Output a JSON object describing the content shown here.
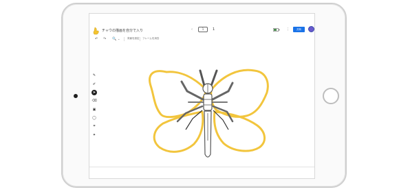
{
  "app": {
    "doc_title": "チャウの描画を自分で入り",
    "frame_current": "1",
    "frame_total": "1",
    "share_label": "共有",
    "accent_color": "#1a73e8",
    "brand_color": "#f4c430"
  },
  "toolbar": {
    "undo_icon": "undo-icon",
    "redo_icon": "redo-icon",
    "zoom_icon": "zoom-icon",
    "background_label": "背景を設定",
    "frame_label": "フレームを消去"
  },
  "sidebar": {
    "tools": [
      {
        "name": "pen-icon",
        "glyph": "✎"
      },
      {
        "name": "marker-icon",
        "glyph": "✐"
      },
      {
        "name": "select-icon",
        "glyph": "➤"
      },
      {
        "name": "eraser-icon",
        "glyph": "⌫"
      },
      {
        "name": "image-icon",
        "glyph": "▣"
      },
      {
        "name": "shape-icon",
        "glyph": "◯"
      },
      {
        "name": "crop-icon",
        "glyph": "⌗"
      },
      {
        "name": "laser-icon",
        "glyph": "✦"
      }
    ]
  },
  "drawing": {
    "subject": "butterfly",
    "wing_color": "#f2c53d",
    "body_color": "#555555",
    "leg_color": "#666666"
  }
}
